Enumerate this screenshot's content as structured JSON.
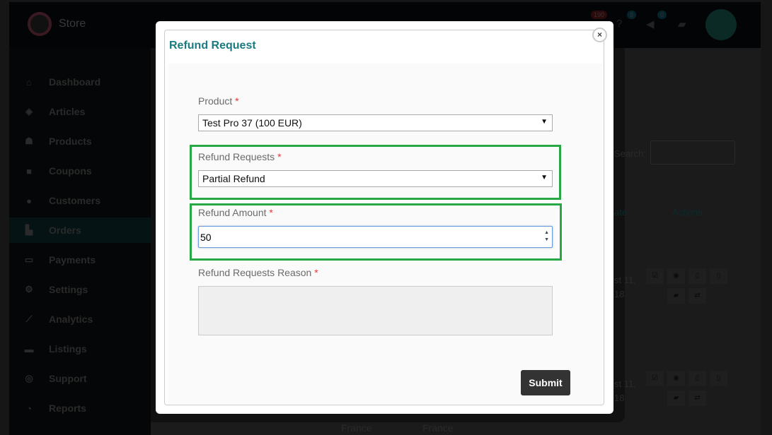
{
  "app": {
    "brand": "Store",
    "notifications": {
      "alerts": "190",
      "help": "8",
      "announcements": "0"
    }
  },
  "sidebar": {
    "items": [
      {
        "label": "Dashboard",
        "icon": "home-icon"
      },
      {
        "label": "Articles",
        "icon": "cube-icon"
      },
      {
        "label": "Products",
        "icon": "cubes-icon"
      },
      {
        "label": "Coupons",
        "icon": "gift-icon"
      },
      {
        "label": "Customers",
        "icon": "user-circle-icon"
      },
      {
        "label": "Orders",
        "icon": "cart-icon",
        "active": true
      },
      {
        "label": "Payments",
        "icon": "credit-card-icon"
      },
      {
        "label": "Settings",
        "icon": "gears-icon"
      },
      {
        "label": "Analytics",
        "icon": "chart-line-icon"
      },
      {
        "label": "Listings",
        "icon": "briefcase-icon"
      },
      {
        "label": "Support",
        "icon": "life-ring-icon"
      },
      {
        "label": "Reports",
        "icon": "pie-chart-icon"
      }
    ]
  },
  "background": {
    "search_label": "Search:",
    "col_date": "ate",
    "col_actions": "Actions",
    "row1_date": "st 11,",
    "row1_year": "18",
    "row2_date": "st 11,",
    "row2_year": "18",
    "country1": "France",
    "country2": "France"
  },
  "modal": {
    "title": "Refund Request",
    "close": "×",
    "product": {
      "label": "Product",
      "required": "*",
      "value": "Test Pro 37 (100 EUR)"
    },
    "refund_type": {
      "label": "Refund Requests",
      "required": "*",
      "value": "Partial Refund"
    },
    "amount": {
      "label": "Refund Amount",
      "required": "*",
      "value": "50"
    },
    "reason": {
      "label": "Refund Requests Reason",
      "required": "*",
      "value": ""
    },
    "submit": "Submit"
  },
  "colors": {
    "accent": "#1a7b82",
    "highlight": "#27a844",
    "required": "#e33333"
  }
}
